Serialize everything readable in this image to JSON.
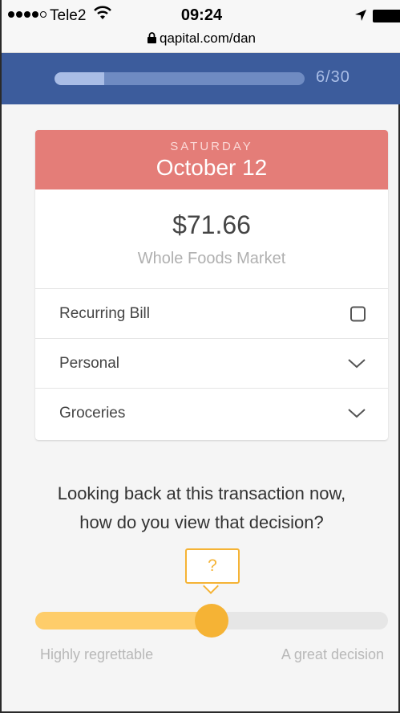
{
  "status_bar": {
    "carrier": "Tele2",
    "time": "09:24",
    "url": "qapital.com/dan",
    "signal_bars_filled": 4,
    "signal_bars_total": 5
  },
  "progress": {
    "current": 6,
    "total": 30,
    "label": "6/30",
    "fraction": 0.2
  },
  "transaction": {
    "day": "SATURDAY",
    "date": "October 12",
    "amount": "$71.66",
    "merchant": "Whole Foods Market",
    "rows": [
      {
        "label": "Recurring Bill",
        "control": "checkbox",
        "checked": false
      },
      {
        "label": "Personal",
        "control": "dropdown"
      },
      {
        "label": "Groceries",
        "control": "dropdown"
      }
    ]
  },
  "question": {
    "line1": "Looking back at this transaction now,",
    "line2": "how do you view that decision?",
    "tooltip": "?"
  },
  "slider": {
    "value": 0.5,
    "min_label": "Highly regrettable",
    "max_label": "A great decision"
  },
  "colors": {
    "header_blue": "#3c5c9c",
    "date_coral": "#e47d78",
    "accent_yellow": "#f5b335"
  }
}
